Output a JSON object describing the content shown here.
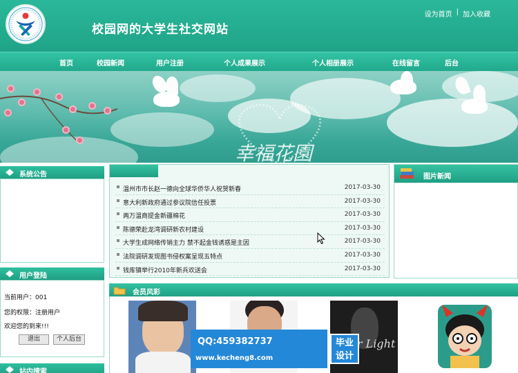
{
  "header": {
    "site_title": "校园网的大学生社交网站",
    "set_home": "设为首页",
    "separator": "|",
    "add_favorite": "加入收藏"
  },
  "nav": {
    "items": [
      "首页",
      "校园新闻",
      "用户注册",
      "个人成果展示",
      "个人相册展示",
      "在线留言",
      "后台"
    ]
  },
  "sidebar": {
    "announcement_title": "系统公告",
    "login_title": "用户登陆",
    "current_user_label": "当前用户：001",
    "permission_label": "您的权限：注册用户",
    "welcome_text": "欢迎您的到来!!!",
    "logout_button": "退出",
    "personal_backend_button": "个人后台",
    "site_search_title": "站内搜索"
  },
  "news": {
    "items": [
      {
        "title": "温州市市长赵一德向全球华侨华人祝贺新春",
        "date": "2017-03-30"
      },
      {
        "title": "意大利新政府通过参议院信任投票",
        "date": "2017-03-30"
      },
      {
        "title": "两万温商提金新疆棉花",
        "date": "2017-03-30"
      },
      {
        "title": "陈德荣赴龙湾调研新农村建设",
        "date": "2017-03-30"
      },
      {
        "title": "大学生成网络传销主力 禁不起金钱诱惑是主因",
        "date": "2017-03-30"
      },
      {
        "title": "法院调研发现图书侵权案呈现五特点",
        "date": "2017-03-30"
      },
      {
        "title": "钱库镇举行2010年新兵欢送会",
        "date": "2017-03-30"
      }
    ]
  },
  "picture_news": {
    "title": "图片新闻"
  },
  "members": {
    "title": "会员风彩",
    "album_caption": "Star Light"
  },
  "watermark": {
    "qq": "QQ:459382737",
    "url": "www.kecheng8.com",
    "badge_line1": "毕业",
    "badge_line2": "设计"
  },
  "colors": {
    "brand_green": "#21a98c",
    "watermark_blue": "#2488d8"
  }
}
